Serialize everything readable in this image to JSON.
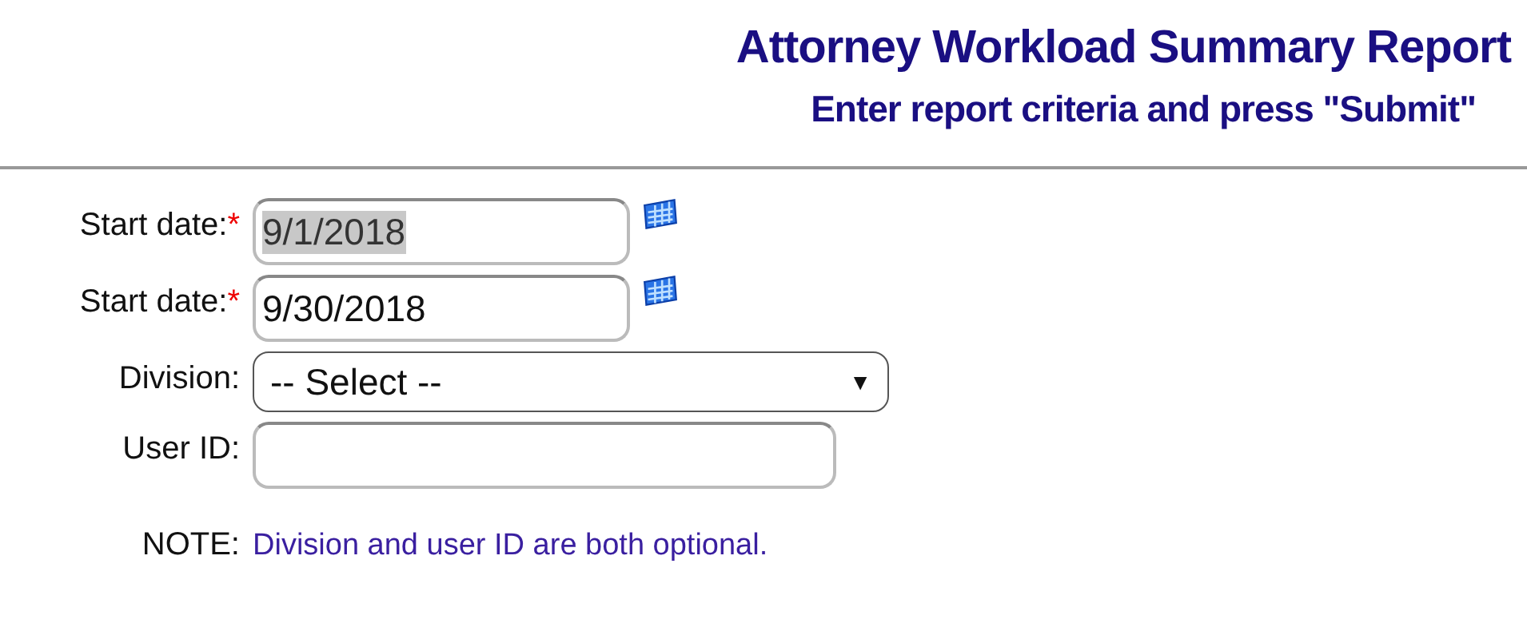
{
  "header": {
    "title": "Attorney Workload Summary Report",
    "subtitle": "Enter report criteria and press \"Submit\""
  },
  "fields": [
    {
      "kind": "date",
      "label": "Start date:",
      "required_mark": "*",
      "value": "9/1/2018",
      "highlighted": true
    },
    {
      "kind": "date",
      "label": "Start date:",
      "required_mark": "*",
      "value": "9/30/2018",
      "highlighted": false
    },
    {
      "kind": "select",
      "label": "Division:",
      "value": "-- Select --",
      "arrow": "▼"
    },
    {
      "kind": "text",
      "label": "User ID:"
    }
  ],
  "note": {
    "label": "NOTE:",
    "text": "Division and user ID are both optional."
  }
}
